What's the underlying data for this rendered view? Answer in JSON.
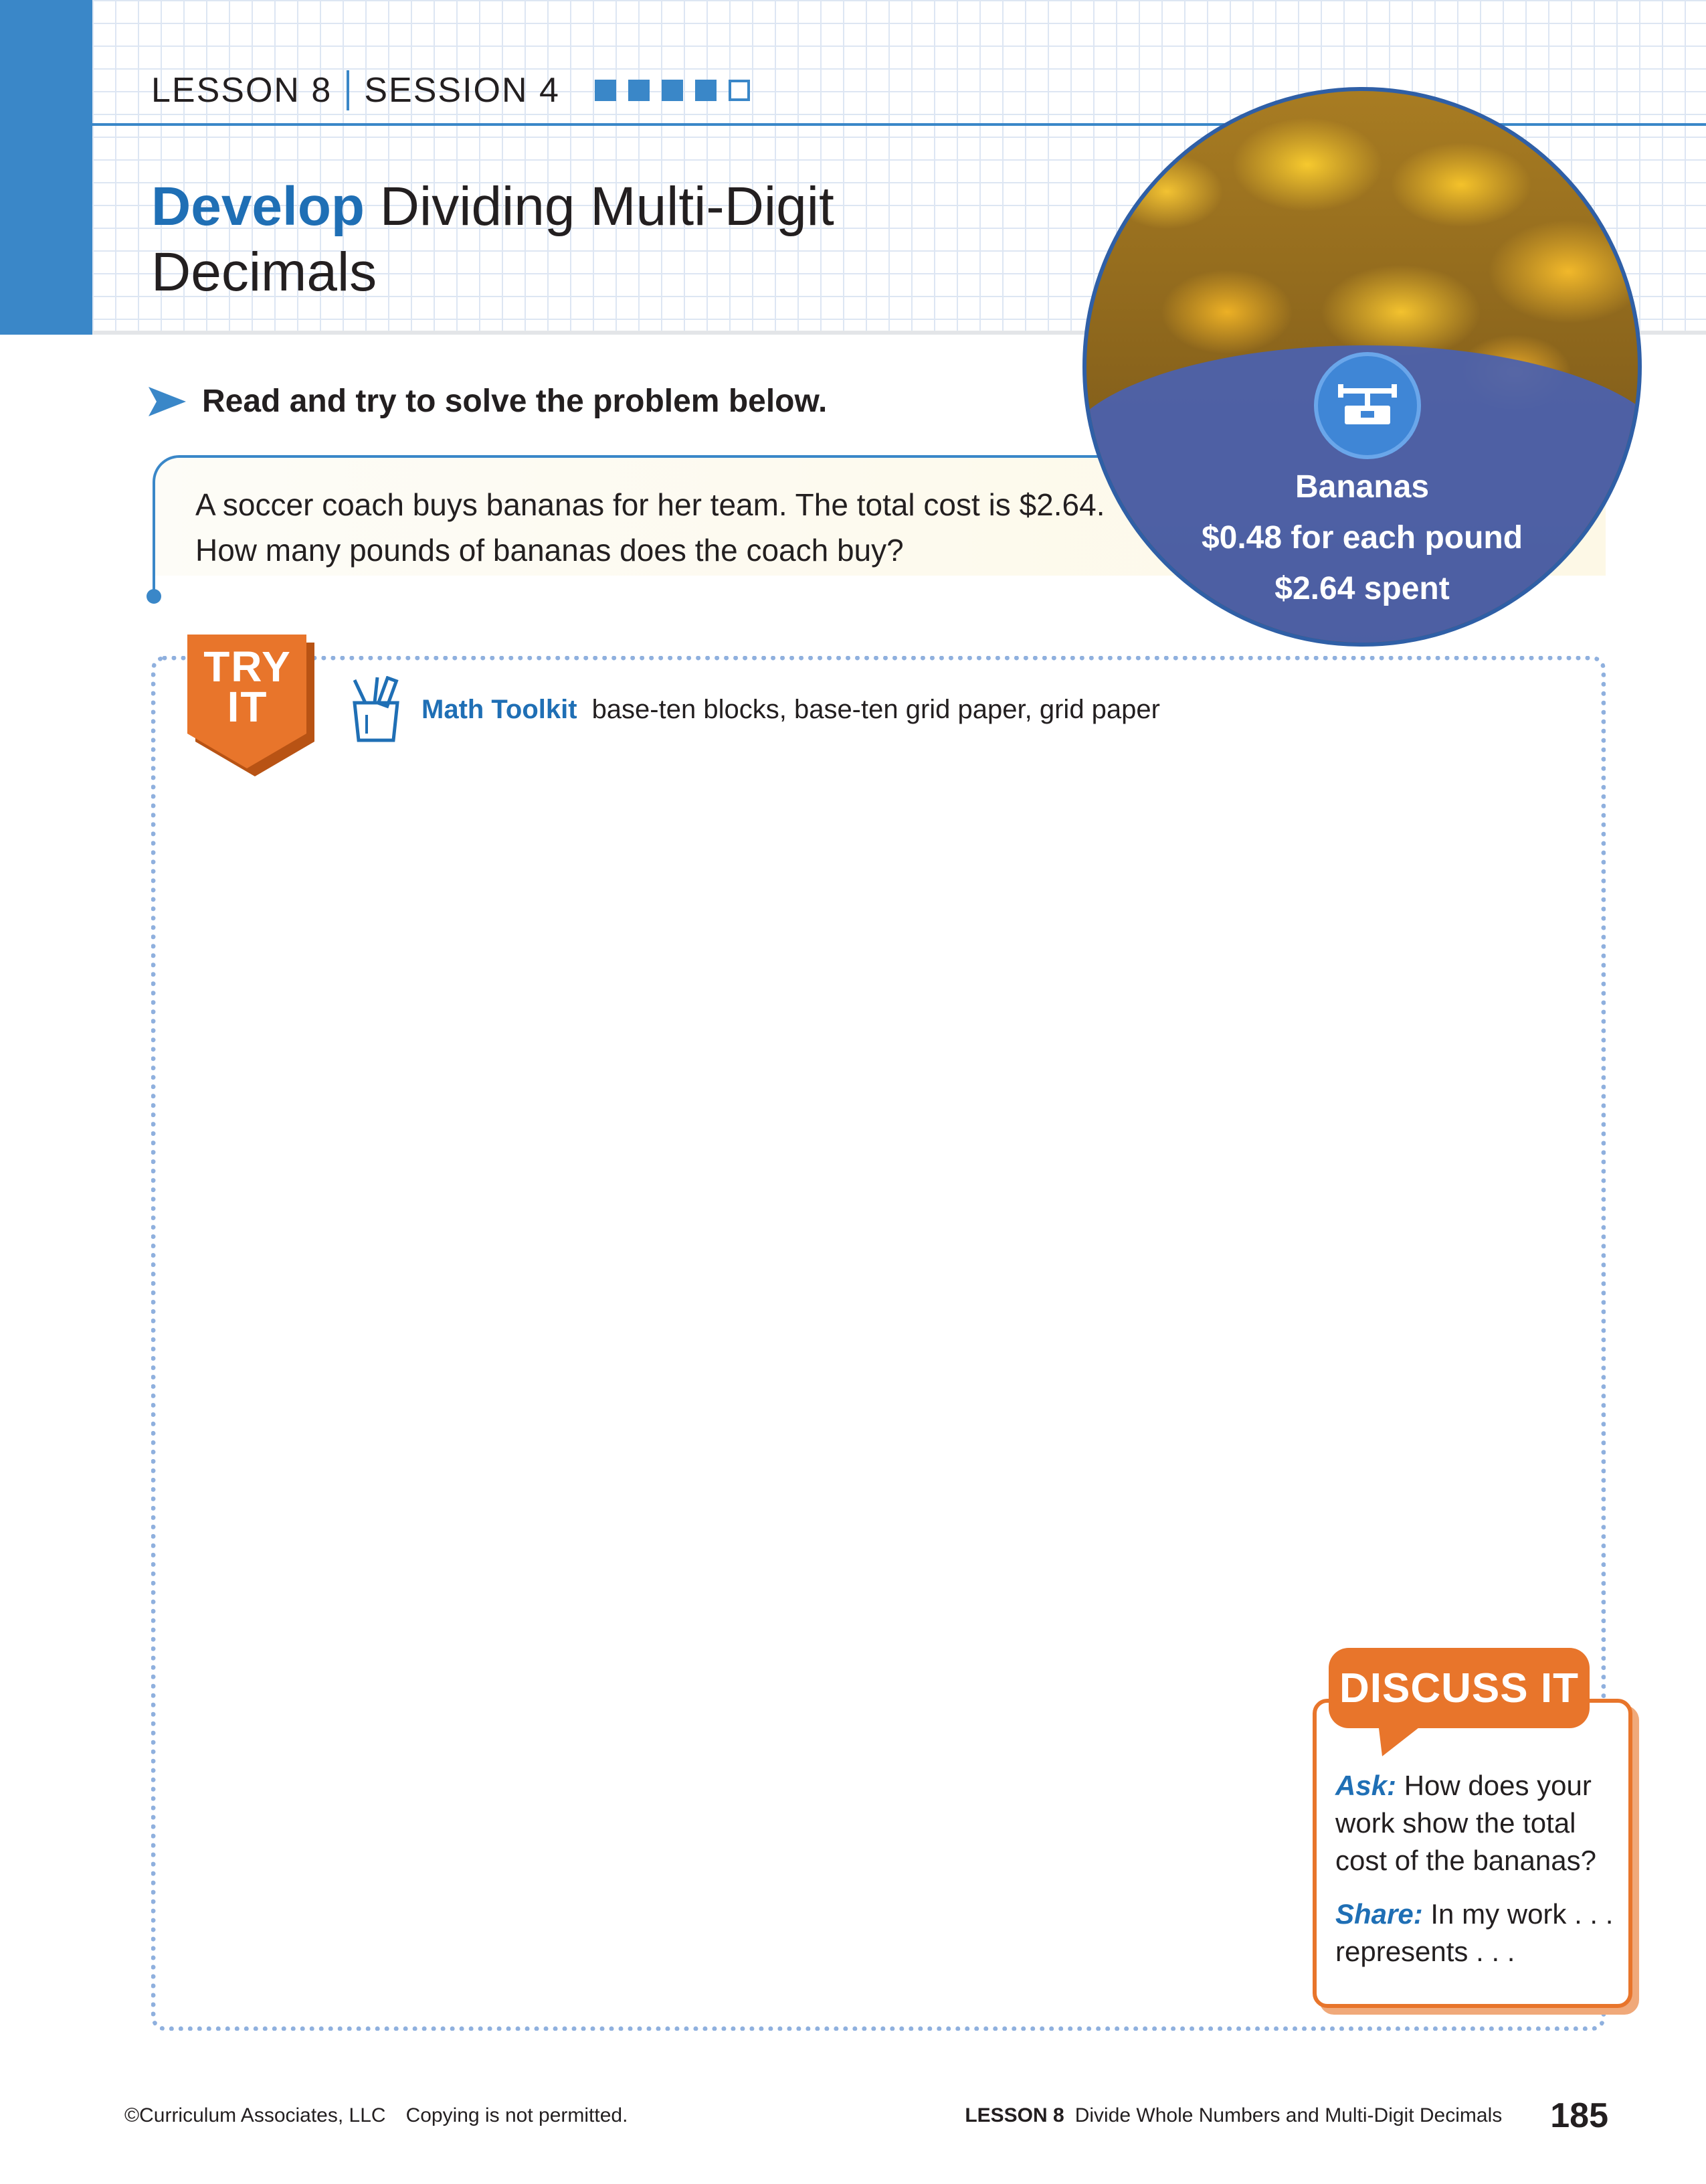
{
  "header": {
    "lesson": "LESSON 8",
    "session": "SESSION 4",
    "progress": {
      "completed": 4,
      "total": 5
    },
    "title_emphasis": "Develop",
    "title_line1": "Dividing Multi-Digit",
    "title_line2": "Decimals"
  },
  "instruction": "Read and try to solve the problem below.",
  "problem": {
    "line1": "A soccer coach buys bananas for her team. The total cost is $2.64.",
    "line2": "How many pounds of bananas does the coach buy?"
  },
  "photo": {
    "icon": "scale-icon",
    "caption_line1": "Bananas",
    "caption_line2": "$0.48 for each pound",
    "caption_line3": "$2.64 spent"
  },
  "try_it": {
    "badge_line1": "TRY",
    "badge_line2": "IT",
    "toolkit_icon": "pencil-cup-icon",
    "toolkit_label": "Math Toolkit",
    "toolkit_items": "base-ten blocks, base-ten grid paper, grid paper"
  },
  "discuss_it": {
    "title": "DISCUSS IT",
    "ask_label": "Ask:",
    "ask_text": "How does your work show the total cost of the bananas?",
    "share_label": "Share:",
    "share_text": "In my work . . . represents . . ."
  },
  "footer": {
    "copyright": "©Curriculum Associates, LLC",
    "notice": "Copying is not permitted.",
    "lesson_tag": "LESSON 8",
    "lesson_title": "Divide Whole Numbers and Multi-Digit Decimals",
    "page_number": "185"
  },
  "colors": {
    "accent_blue": "#3a87c8",
    "title_blue": "#1f6fb5",
    "orange": "#e8752b",
    "dotted_border": "#8fb0de"
  }
}
